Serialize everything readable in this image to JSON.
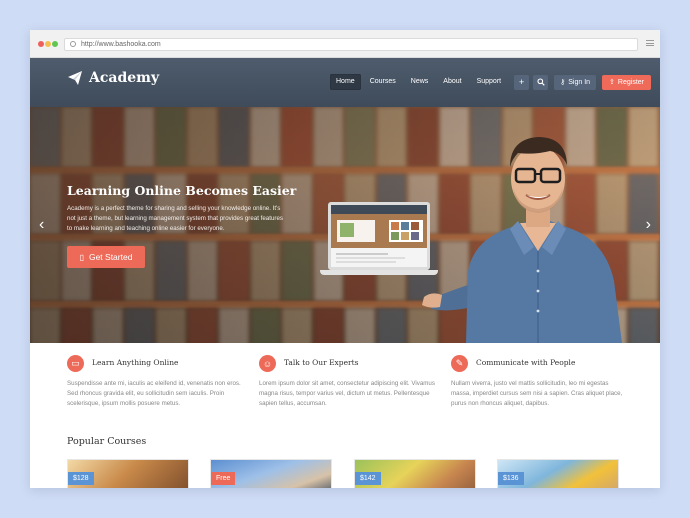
{
  "browser": {
    "url": "http://www.bashooka.com"
  },
  "header": {
    "logo_text": "Academy",
    "nav": [
      "Home",
      "Courses",
      "News",
      "About",
      "Support"
    ],
    "active_nav": "Home",
    "plus_glyph": "+",
    "search_glyph": "⌕",
    "signin_label": "Sign In",
    "register_label": "Register"
  },
  "hero": {
    "title": "Learning Online Becomes Easier",
    "description": "Academy is a perfect theme for sharing and selling your knowledge online. It's not just a theme, but learning management system that provides great features to make learning and teaching online easier for everyone.",
    "cta_label": "Get Started",
    "prev_glyph": "‹",
    "next_glyph": "›"
  },
  "features": [
    {
      "icon": "monitor-icon",
      "title": "Learn Anything Online",
      "text": "Suspendisse ante mi, iaculis ac eleifend id, venenatis non eros. Sed rhoncus gravida elit, eu sollicitudin sem iaculis. Proin scelerisque, ipsum mollis posuere metus."
    },
    {
      "icon": "user-icon",
      "title": "Talk to Our Experts",
      "text": "Lorem ipsum dolor sit amet, consectetur adipiscing elit. Vivamus magna risus, tempor varius vel, dictum ut metus. Pellentesque sapien tellus, accumsan."
    },
    {
      "icon": "chat-icon",
      "title": "Communicate with People",
      "text": "Nullam viverra, justo vel mattis sollicitudin, leo mi egestas massa, imperdiet cursus sem nisi a sapien. Cras aliquet place, purus non rhoncus aliquet, dapibus."
    }
  ],
  "popular": {
    "title": "Popular Courses",
    "courses": [
      {
        "price": "$128"
      },
      {
        "price": "Free"
      },
      {
        "price": "$142"
      },
      {
        "price": "$136"
      }
    ]
  },
  "colors": {
    "accent": "#ee6a58",
    "header_bg": "#46525f",
    "price_badge": "#5b94d4",
    "page_bg": "#cfdcf5"
  }
}
